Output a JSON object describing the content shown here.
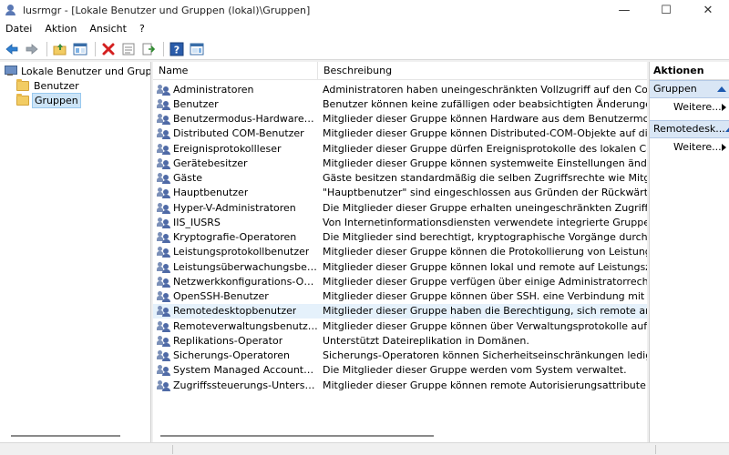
{
  "window": {
    "title": "lusrmgr - [Lokale Benutzer und Gruppen (lokal)\\Gruppen]",
    "minimize_glyph": "—",
    "maximize_glyph": "☐",
    "close_glyph": "✕"
  },
  "menu": [
    "Datei",
    "Aktion",
    "Ansicht",
    "?"
  ],
  "toolbar": {
    "icons": [
      "back-arrow-icon",
      "forward-arrow-icon",
      "up-folder-icon",
      "show-hide-tree-icon",
      "delete-icon",
      "properties-icon",
      "export-list-icon",
      "help-icon",
      "show-hide-action-pane-icon"
    ]
  },
  "tree": {
    "root": "Lokale Benutzer und Gruppen (lokal)",
    "children": [
      "Benutzer",
      "Gruppen"
    ],
    "selected": "Gruppen"
  },
  "list": {
    "columns": [
      "Name",
      "Beschreibung"
    ],
    "selected_row": "Remotedesktopbenutzer",
    "rows": [
      {
        "name": "Administratoren",
        "desc": "Administratoren haben uneingeschränkten Vollzugriff auf den Computer bzw."
      },
      {
        "name": "Benutzer",
        "desc": "Benutzer können keine zufälligen oder beabsichtigten Änderungen am System"
      },
      {
        "name": "Benutzermodus-Hardwareoperat...",
        "desc": "Mitglieder dieser Gruppe können Hardware aus dem Benutzermodus betreiben"
      },
      {
        "name": "Distributed COM-Benutzer",
        "desc": "Mitglieder dieser Gruppe können Distributed-COM-Objekte auf diesem Compu"
      },
      {
        "name": "Ereignisprotokollleser",
        "desc": "Mitglieder dieser Gruppe dürfen Ereignisprotokolle des lokalen Computers lese"
      },
      {
        "name": "Gerätebesitzer",
        "desc": "Mitglieder dieser Gruppe können systemweite Einstellungen ändern."
      },
      {
        "name": "Gäste",
        "desc": "Gäste besitzen standardmäßig die selben Zugriffsrechte wie Mitglieder der Ben"
      },
      {
        "name": "Hauptbenutzer",
        "desc": "\"Hauptbenutzer\" sind eingeschlossen aus Gründen der Rückwärtskompatibilität"
      },
      {
        "name": "Hyper-V-Administratoren",
        "desc": "Die Mitglieder dieser Gruppe erhalten uneingeschränkten Zugriff auf sämtliche"
      },
      {
        "name": "IIS_IUSRS",
        "desc": "Von Internetinformationsdiensten verwendete integrierte Gruppe."
      },
      {
        "name": "Kryptografie-Operatoren",
        "desc": "Die Mitglieder sind berechtigt, kryptographische Vorgänge durchzuführen."
      },
      {
        "name": "Leistungsprotokollbenutzer",
        "desc": "Mitglieder dieser Gruppe können die Protokollierung von Leistungsindikatoren"
      },
      {
        "name": "Leistungsüberwachungsbenutzer",
        "desc": "Mitglieder dieser Gruppe können lokal und remote auf Leistungszählerdaten zu"
      },
      {
        "name": "Netzwerkkonfigurations-Operato...",
        "desc": "Mitglieder dieser Gruppe verfügen über einige Administratorrechte zum Verwal"
      },
      {
        "name": "OpenSSH-Benutzer",
        "desc": "Mitglieder dieser Gruppe können über SSH. eine Verbindung mit diesem Comp"
      },
      {
        "name": "Remotedesktopbenutzer",
        "desc": "Mitglieder dieser Gruppe haben die Berechtigung, sich remote anzumelden."
      },
      {
        "name": "Remoteverwaltungsbenutzer",
        "desc": "Mitglieder dieser Gruppe können über Verwaltungsprotokolle auf WMI-Ressour"
      },
      {
        "name": "Replikations-Operator",
        "desc": "Unterstützt Dateireplikation in Domänen."
      },
      {
        "name": "Sicherungs-Operatoren",
        "desc": "Sicherungs-Operatoren können Sicherheitseinschränkungen lediglich zum Sich"
      },
      {
        "name": "System Managed Accounts Group",
        "desc": "Die Mitglieder dieser Gruppe werden vom System verwaltet."
      },
      {
        "name": "Zugriffssteuerungs-Unterstützun...",
        "desc": "Mitglieder dieser Gruppe können remote Autorisierungsattribute und -berechti"
      }
    ]
  },
  "actions": {
    "title": "Aktionen",
    "sections": [
      {
        "label": "Gruppen",
        "item": "Weitere..."
      },
      {
        "label": "Remotedesk...",
        "item": "Weitere..."
      }
    ]
  },
  "colors": {
    "selection_bg": "#cce4f7",
    "row_selected_bg": "#e5f1fb",
    "action_section_bg": "#d9e6f5",
    "accent_blue": "#1e5ab0"
  }
}
